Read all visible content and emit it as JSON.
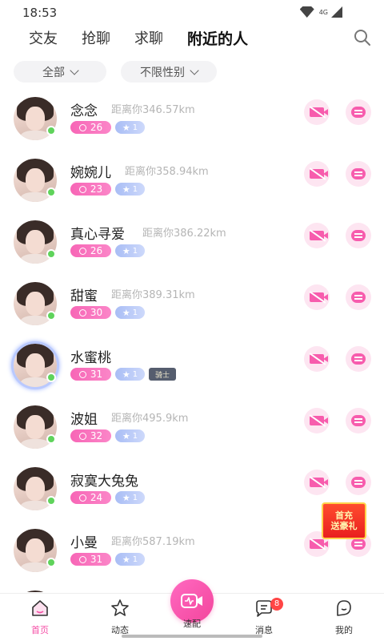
{
  "status_bar": {
    "time": "18:53",
    "network": "4G"
  },
  "tabs": [
    {
      "label": "交友"
    },
    {
      "label": "抢聊"
    },
    {
      "label": "求聊"
    },
    {
      "label": "附近的人"
    }
  ],
  "active_tab": "附近的人",
  "filters": {
    "scope": "全部",
    "gender": "不限性别"
  },
  "users": [
    {
      "name": "念念",
      "distance": "距离你346.57km",
      "age": "26",
      "level": "1",
      "online": true
    },
    {
      "name": "婉婉儿",
      "distance": "距离你358.94km",
      "age": "23",
      "level": "1",
      "online": true
    },
    {
      "name": "真心寻爱",
      "distance": "距离你386.22km",
      "age": "26",
      "level": "1",
      "online": true
    },
    {
      "name": "甜蜜",
      "distance": "距离你389.31km",
      "age": "30",
      "level": "1",
      "online": true
    },
    {
      "name": "水蜜桃",
      "distance": "",
      "age": "31",
      "level": "1",
      "vip": "骑士",
      "online": true
    },
    {
      "name": "波姐",
      "distance": "距离你495.9km",
      "age": "32",
      "level": "1",
      "online": true
    },
    {
      "name": "寂寞大兔兔",
      "distance": "",
      "age": "24",
      "level": "1",
      "online": true
    },
    {
      "name": "小曼",
      "distance": "距离你587.19km",
      "age": "31",
      "level": "1",
      "online": true
    }
  ],
  "gift_banner": {
    "line1": "首充",
    "line2": "送豪礼"
  },
  "bottom_nav": {
    "home": "首页",
    "moments": "动态",
    "match": "速配",
    "messages": "消息",
    "messages_badge": "8",
    "mine": "我的"
  },
  "colors": {
    "accent": "#f54ea6",
    "online": "#5fd35b",
    "badge_bg": "#ff4545"
  }
}
